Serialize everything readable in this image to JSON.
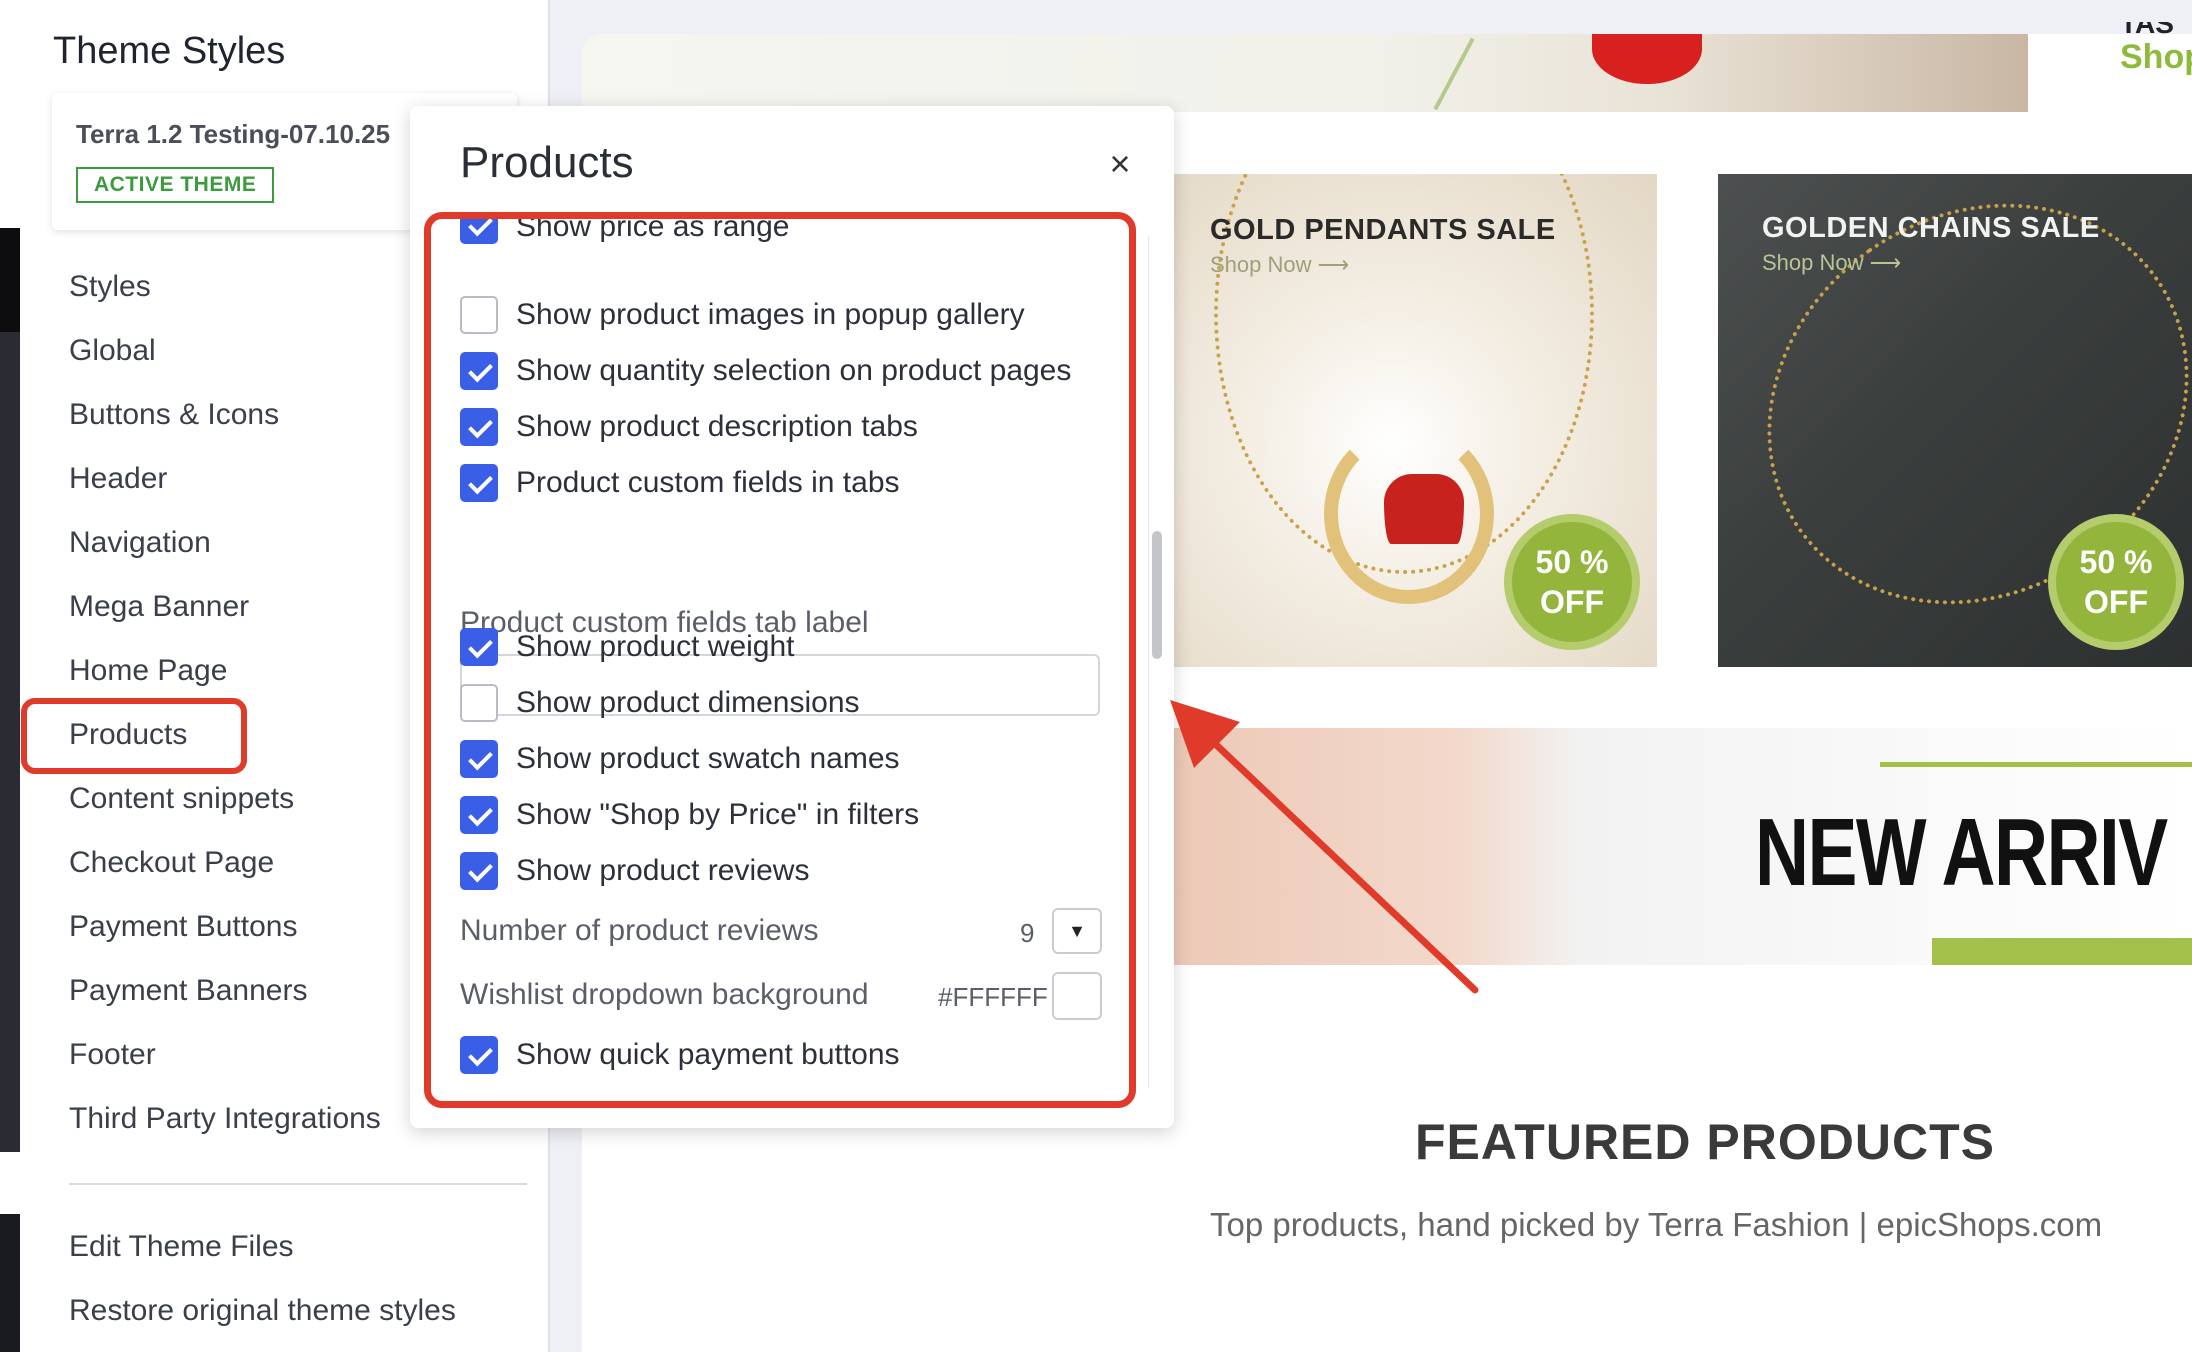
{
  "sidebar": {
    "title": "Theme Styles",
    "theme_name": "Terra 1.2 Testing-07.10.25",
    "theme_badge": "ACTIVE THEME",
    "items": [
      {
        "label": "Styles"
      },
      {
        "label": "Global"
      },
      {
        "label": "Buttons & Icons"
      },
      {
        "label": "Header"
      },
      {
        "label": "Navigation"
      },
      {
        "label": "Mega Banner"
      },
      {
        "label": "Home Page"
      },
      {
        "label": "Products"
      },
      {
        "label": "Content snippets"
      },
      {
        "label": "Checkout Page"
      },
      {
        "label": "Payment Buttons"
      },
      {
        "label": "Payment Banners"
      },
      {
        "label": "Footer"
      },
      {
        "label": "Third Party Integrations"
      }
    ],
    "footer_items": [
      {
        "label": "Edit Theme Files"
      },
      {
        "label": "Restore original theme styles"
      }
    ]
  },
  "panel": {
    "title": "Products",
    "close_label": "×",
    "options": [
      {
        "label": "Show price as range",
        "checked": true
      },
      {
        "label": "Show product images in popup gallery",
        "checked": false
      },
      {
        "label": "Show quantity selection on product pages",
        "checked": true
      },
      {
        "label": "Show product description tabs",
        "checked": true
      },
      {
        "label": "Product custom fields in tabs",
        "checked": true
      }
    ],
    "custom_tab_label": {
      "label": "Product custom fields tab label",
      "value": ""
    },
    "options2": [
      {
        "label": "Show product weight",
        "checked": true
      },
      {
        "label": "Show product dimensions",
        "checked": false
      },
      {
        "label": "Show product swatch names",
        "checked": true
      },
      {
        "label": "Show \"Shop by Price\" in filters",
        "checked": true
      },
      {
        "label": "Show product reviews",
        "checked": true
      }
    ],
    "reviews_count": {
      "label": "Number of product reviews",
      "value": "9"
    },
    "wishlist_bg": {
      "label": "Wishlist dropdown background",
      "value": "#FFFFFF"
    },
    "quick_pay": {
      "label": "Show quick payment buttons",
      "checked": true
    }
  },
  "preview": {
    "shop_peek": "Shop",
    "promo_1": {
      "title": "GOLD PENDANTS SALE",
      "sub": "Shop Now",
      "discount_top": "50 %",
      "discount_bottom": "OFF"
    },
    "promo_2": {
      "title": "GOLDEN CHAINS SALE",
      "sub": "Shop Now",
      "discount_top": "50 %",
      "discount_bottom": "OFF"
    },
    "new_arrivals": "NEW ARRIV",
    "featured_title": "FEATURED PRODUCTS",
    "featured_sub": "Top products, hand picked by Terra Fashion | epicShops.com"
  },
  "colors": {
    "accent_checkbox": "#3b5ee6",
    "annotation_red": "#e03a2a",
    "active_badge_green": "#3e9a3e",
    "promo_green": "#93b53b"
  }
}
